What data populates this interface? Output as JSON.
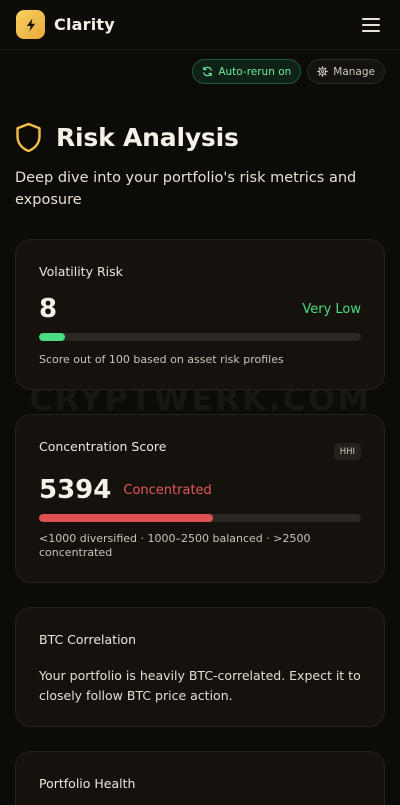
{
  "header": {
    "app_name": "Clarity",
    "logo_icon": "lightning-bolt-icon",
    "menu_icon": "hamburger-menu-icon"
  },
  "toolbar": {
    "auto_rerun_label": "Auto-rerun on",
    "manage_label": "Manage"
  },
  "page": {
    "title": "Risk Analysis",
    "subtitle": "Deep dive into your portfolio's risk metrics and exposure",
    "title_icon": "shield-icon"
  },
  "volatility": {
    "title": "Volatility Risk",
    "score": "8",
    "level": "Very Low",
    "bar_fraction": 0.08,
    "bar_color": "#4ade80",
    "level_color": "#4ade80",
    "note": "Score out of 100 based on asset risk profiles"
  },
  "concentration": {
    "title": "Concentration Score",
    "badge": "HHI",
    "score": "5394",
    "level": "Concentrated",
    "bar_fraction": 0.54,
    "bar_color": "#e05252",
    "level_color": "#e05a55",
    "note": "<1000 diversified · 1000–2500 balanced · >2500 concentrated"
  },
  "btc": {
    "title": "BTC Correlation",
    "text": "Your portfolio is heavily BTC-correlated. Expect it to closely follow BTC price action."
  },
  "health": {
    "title": "Portfolio Health"
  },
  "watermark": "CRYPTWERK.COM",
  "colors": {
    "accent": "#f2c04a",
    "background": "#0d0b08",
    "card": "#15120e"
  }
}
